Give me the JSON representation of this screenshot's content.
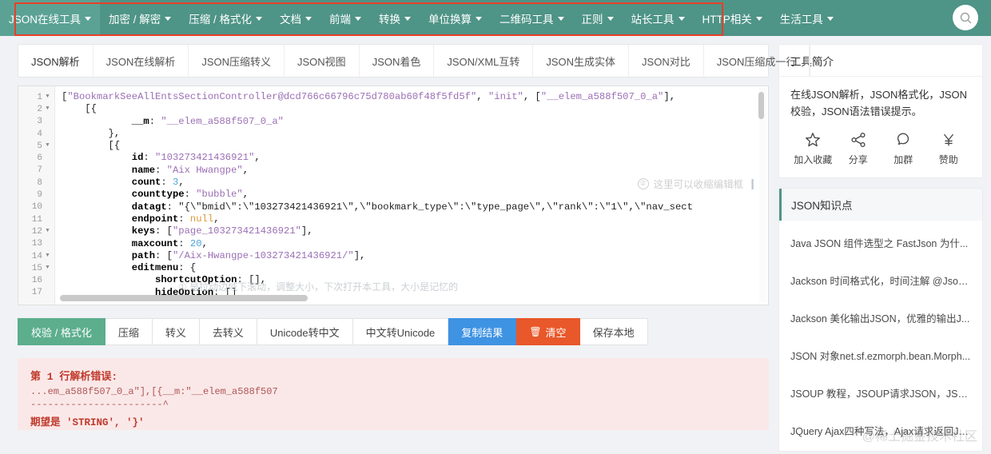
{
  "nav": {
    "items": [
      {
        "label": "JSON在线工具",
        "active": true
      },
      {
        "label": "加密 / 解密",
        "active": false
      },
      {
        "label": "压缩 / 格式化",
        "active": false
      },
      {
        "label": "文档",
        "active": false
      },
      {
        "label": "前端",
        "active": false
      },
      {
        "label": "转换",
        "active": false
      },
      {
        "label": "单位换算",
        "active": false
      },
      {
        "label": "二维码工具",
        "active": false
      },
      {
        "label": "正则",
        "active": false
      },
      {
        "label": "站长工具",
        "active": false
      },
      {
        "label": "HTTP相关",
        "active": false
      },
      {
        "label": "生活工具",
        "active": false
      }
    ],
    "search_icon": "search-icon",
    "highlight_color": "#e8402a",
    "bar_color": "#4e9487"
  },
  "tabs": {
    "items": [
      {
        "label": "JSON解析",
        "active": true
      },
      {
        "label": "JSON在线解析",
        "active": false
      },
      {
        "label": "JSON压缩转义",
        "active": false
      },
      {
        "label": "JSON视图",
        "active": false
      },
      {
        "label": "JSON着色",
        "active": false
      },
      {
        "label": "JSON/XML互转",
        "active": false
      },
      {
        "label": "JSON生成实体",
        "active": false
      },
      {
        "label": "JSON对比",
        "active": false
      },
      {
        "label": "JSON压缩成一行",
        "active": false
      }
    ],
    "more_icon": "chevron-down-icon"
  },
  "editor": {
    "line_numbers": [
      "1",
      "2",
      "3",
      "4",
      "5",
      "6",
      "7",
      "8",
      "9",
      "10",
      "11",
      "12",
      "13",
      "14",
      "15",
      "16",
      "17"
    ],
    "folds": [
      true,
      true,
      false,
      false,
      true,
      false,
      false,
      false,
      false,
      false,
      false,
      true,
      false,
      true,
      true,
      false,
      false
    ],
    "lines": [
      "[\"BookmarkSeeAllEntsSectionController@dcd766c66796c75d780ab60f48f5fd5f\", \"init\", [\"__elem_a588f507_0_a\"],",
      "    [{",
      "            __m: \"__elem_a588f507_0_a\"",
      "        },",
      "        [{",
      "            id: \"103273421436921\",",
      "            name: \"Aix Hwangpe\",",
      "            count: 3,",
      "            counttype: \"bubble\",",
      "            datagt: \"{\\\"bmid\\\":\\\"103273421436921\\\",\\\"bookmark_type\\\":\\\"type_page\\\",\\\"rank\\\":\\\"1\\\",\\\"nav_sect",
      "            endpoint: null,",
      "            keys: [\"page_103273421436921\"],",
      "            maxcount: 20,",
      "            path: [\"/Aix-Hwangpe-103273421436921/\"],",
      "            editmenu: {",
      "                shortcutOption: [],",
      "                hideOption: []"
    ],
    "hint_overlay": "这里可以收缩编辑框",
    "hint_overlay_badge": "②",
    "hint_bottom": "① 是拉动边域下滚动，调整大小，下次打开本工具，大小是记忆的",
    "collapse_icon": "chevron-double-right-icon"
  },
  "actions": [
    {
      "label": "校验 / 格式化",
      "style": "green",
      "icon": null
    },
    {
      "label": "压缩",
      "style": "plain",
      "icon": null
    },
    {
      "label": "转义",
      "style": "plain",
      "icon": null
    },
    {
      "label": "去转义",
      "style": "plain",
      "icon": null
    },
    {
      "label": "Unicode转中文",
      "style": "plain",
      "icon": null
    },
    {
      "label": "中文转Unicode",
      "style": "plain",
      "icon": null
    },
    {
      "label": "复制结果",
      "style": "blue",
      "icon": null
    },
    {
      "label": "清空",
      "style": "red",
      "icon": "trash-icon"
    },
    {
      "label": "保存本地",
      "style": "plain",
      "icon": null
    }
  ],
  "error": {
    "title": "第 1 行解析错误:",
    "snippet": "...em_a588f507_0_a\"],[{__m:\"__elem_a588f507",
    "caret": "-----------------------^",
    "expect": "期望是 'STRING', '}'"
  },
  "sidebar": {
    "intro": {
      "title": "工具简介",
      "body": "在线JSON解析，JSON格式化，JSON校验，JSON语法错误提示。",
      "icons": [
        {
          "label": "加入收藏",
          "icon": "star-icon"
        },
        {
          "label": "分享",
          "icon": "share-icon"
        },
        {
          "label": "加群",
          "icon": "chat-bubble-icon"
        },
        {
          "label": "赞助",
          "icon": "yen-icon"
        }
      ]
    },
    "knowledge": {
      "title": "JSON知识点",
      "items": [
        "Java JSON 组件选型之 FastJson 为什...",
        "Jackson 时间格式化，时间注解 @Json...",
        "Jackson 美化输出JSON，优雅的输出J...",
        "JSON 对象net.sf.ezmorph.bean.Morph...",
        "JSOUP 教程，JSOUP请求JSON，JSO...",
        "JQuery Ajax四种写法，Ajax请求返回JS..."
      ]
    },
    "watermark": "@稀土掘金技术社区"
  }
}
